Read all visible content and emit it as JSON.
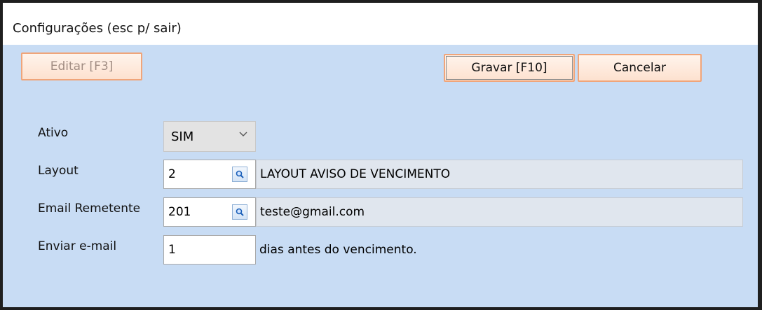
{
  "window": {
    "title": "Configurações (esc p/ sair)"
  },
  "toolbar": {
    "edit_label": "Editar [F3]",
    "save_label": "Gravar [F10]",
    "cancel_label": "Cancelar"
  },
  "form": {
    "ativo": {
      "label": "Ativo",
      "value": "SIM"
    },
    "layout": {
      "label": "Layout",
      "code": "2",
      "description": "LAYOUT AVISO DE VENCIMENTO"
    },
    "email_remetente": {
      "label": "Email Remetente",
      "code": "201",
      "description": "teste@gmail.com"
    },
    "enviar_email": {
      "label": "Enviar e-mail",
      "days": "1",
      "suffix": "dias antes do vencimento."
    }
  },
  "icons": {
    "lookup": "magnifier-icon",
    "dropdown": "chevron-down-icon"
  }
}
